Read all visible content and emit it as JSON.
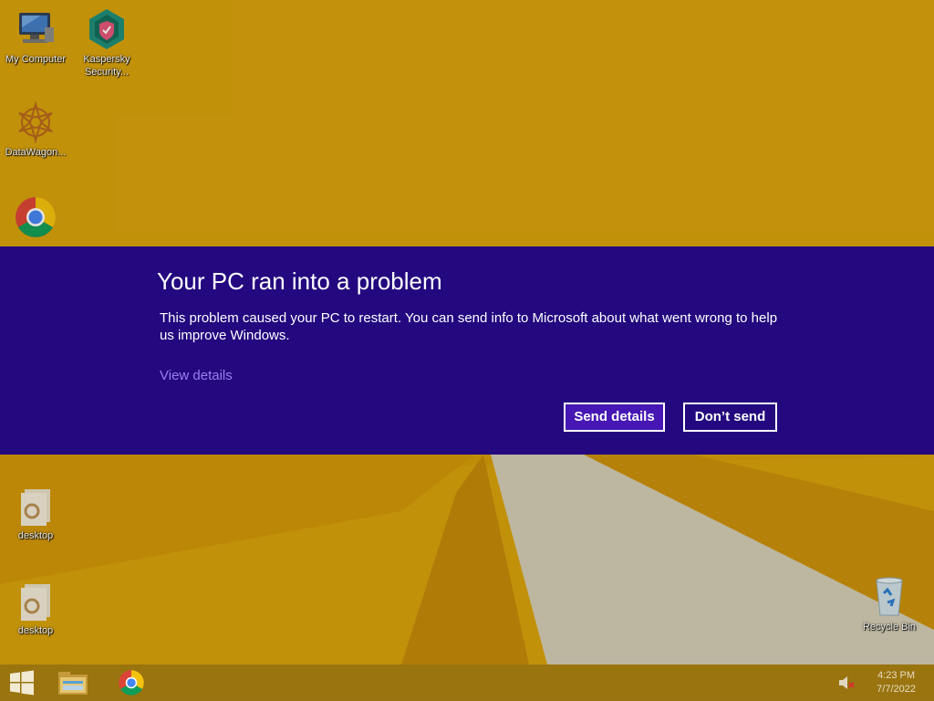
{
  "desktop": {
    "icons": [
      {
        "label": "My Computer"
      },
      {
        "label": "Kaspersky Security..."
      },
      {
        "label": "DataWagon..."
      },
      {
        "label": ""
      },
      {
        "label": "desktop"
      },
      {
        "label": "desktop"
      },
      {
        "label": "Recycle Bin"
      }
    ]
  },
  "dialog": {
    "title": "Your PC ran into a problem",
    "message": "This problem caused your PC to restart. You can send info to Microsoft about what went wrong to help us improve Windows.",
    "view_details": "View details",
    "send_label": "Send details",
    "dont_send_label": "Don’t send"
  },
  "taskbar": {
    "items": [
      {
        "icon": "windows-start-icon"
      },
      {
        "icon": "file-explorer-icon"
      },
      {
        "icon": "chrome-icon"
      }
    ],
    "tray": {
      "volume_icon": "volume-muted-icon",
      "time": "4:23 PM",
      "date": "7/7/2022"
    }
  },
  "colors": {
    "wallpaper": "#d8a10c",
    "dialog_band": "#23087f",
    "send_button": "#4617b4",
    "link": "#9d7df0"
  }
}
